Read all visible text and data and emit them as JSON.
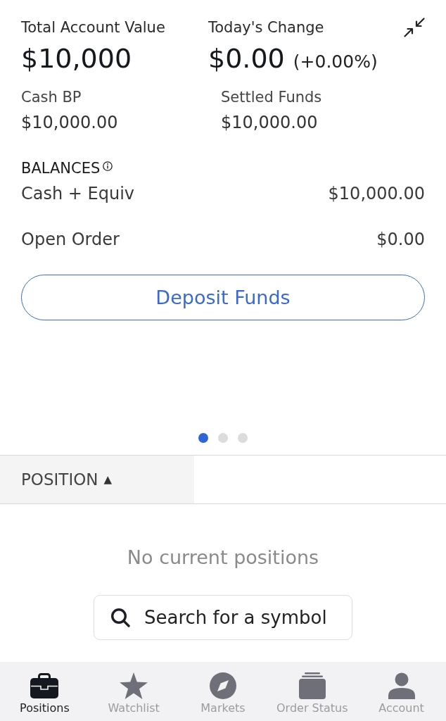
{
  "summary": [
    {
      "label": "Total Account Value",
      "value": "$10,000"
    },
    {
      "label": "Today's Change",
      "value": "$0.00",
      "percent": "(+0.00%)"
    }
  ],
  "funds": [
    {
      "label": "Cash BP",
      "value": "$10,000.00"
    },
    {
      "label": "Settled Funds",
      "value": "$10,000.00"
    }
  ],
  "balances": {
    "title": "BALANCES",
    "rows": [
      {
        "label": "Cash + Equiv",
        "value": "$10,000.00"
      },
      {
        "label": "Open Order",
        "value": "$0.00"
      }
    ]
  },
  "deposit_button": {
    "label": "Deposit Funds"
  },
  "pager": [
    {
      "selected": true
    },
    {
      "selected": false
    },
    {
      "selected": false
    }
  ],
  "positions_table": {
    "columns": [
      {
        "label": "POSITION",
        "sort_indicator": "▲"
      }
    ],
    "empty_message": "No current positions"
  },
  "search": {
    "placeholder": "Search for a symbol"
  },
  "tab_bar": [
    {
      "label": "Positions",
      "selected": true
    },
    {
      "label": "Watchlist",
      "selected": false
    },
    {
      "label": "Markets",
      "selected": false
    },
    {
      "label": "Order Status",
      "selected": false
    },
    {
      "label": "Account",
      "selected": false
    }
  ]
}
